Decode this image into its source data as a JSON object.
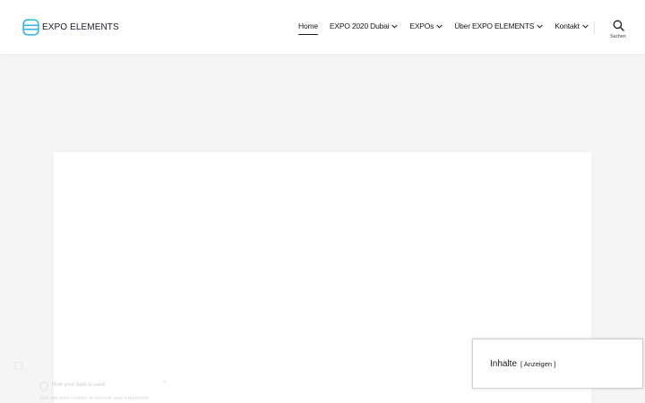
{
  "header": {
    "logo_text": "EXPO ELEMENTS",
    "nav": [
      {
        "label": "Home",
        "active": true,
        "has_dropdown": false
      },
      {
        "label": "EXPO 2020 Dubai",
        "active": false,
        "has_dropdown": true
      },
      {
        "label": "EXPOs",
        "active": false,
        "has_dropdown": true
      },
      {
        "label": "Über EXPO ELEMENTS",
        "active": false,
        "has_dropdown": true
      },
      {
        "label": "Kontakt",
        "active": false,
        "has_dropdown": true
      }
    ],
    "search_label": "Suchen"
  },
  "toc": {
    "title": "Inhalte",
    "toggle_open": "[",
    "toggle_label": "Anzeigen",
    "toggle_close": "]"
  },
  "consent_overlay": {
    "title": "How your data is used",
    "text": "This site uses cookies to improve your experience"
  },
  "colors": {
    "logo_accent": "#2bb3e8",
    "header_bg": "#ffffff",
    "page_bg": "#f5f5f5"
  }
}
